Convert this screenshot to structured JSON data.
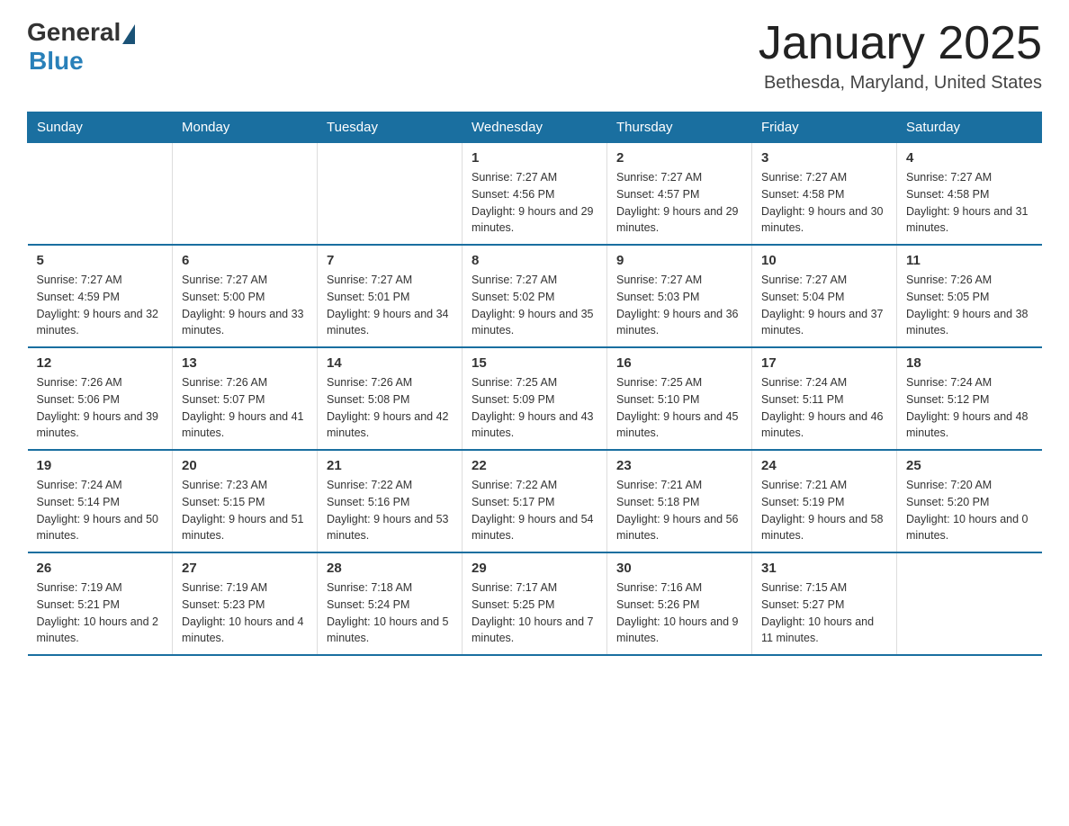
{
  "header": {
    "logo_general": "General",
    "logo_blue": "Blue",
    "month_title": "January 2025",
    "location": "Bethesda, Maryland, United States"
  },
  "days_of_week": [
    "Sunday",
    "Monday",
    "Tuesday",
    "Wednesday",
    "Thursday",
    "Friday",
    "Saturday"
  ],
  "weeks": [
    {
      "days": [
        {
          "number": "",
          "info": ""
        },
        {
          "number": "",
          "info": ""
        },
        {
          "number": "",
          "info": ""
        },
        {
          "number": "1",
          "info": "Sunrise: 7:27 AM\nSunset: 4:56 PM\nDaylight: 9 hours\nand 29 minutes."
        },
        {
          "number": "2",
          "info": "Sunrise: 7:27 AM\nSunset: 4:57 PM\nDaylight: 9 hours\nand 29 minutes."
        },
        {
          "number": "3",
          "info": "Sunrise: 7:27 AM\nSunset: 4:58 PM\nDaylight: 9 hours\nand 30 minutes."
        },
        {
          "number": "4",
          "info": "Sunrise: 7:27 AM\nSunset: 4:58 PM\nDaylight: 9 hours\nand 31 minutes."
        }
      ]
    },
    {
      "days": [
        {
          "number": "5",
          "info": "Sunrise: 7:27 AM\nSunset: 4:59 PM\nDaylight: 9 hours\nand 32 minutes."
        },
        {
          "number": "6",
          "info": "Sunrise: 7:27 AM\nSunset: 5:00 PM\nDaylight: 9 hours\nand 33 minutes."
        },
        {
          "number": "7",
          "info": "Sunrise: 7:27 AM\nSunset: 5:01 PM\nDaylight: 9 hours\nand 34 minutes."
        },
        {
          "number": "8",
          "info": "Sunrise: 7:27 AM\nSunset: 5:02 PM\nDaylight: 9 hours\nand 35 minutes."
        },
        {
          "number": "9",
          "info": "Sunrise: 7:27 AM\nSunset: 5:03 PM\nDaylight: 9 hours\nand 36 minutes."
        },
        {
          "number": "10",
          "info": "Sunrise: 7:27 AM\nSunset: 5:04 PM\nDaylight: 9 hours\nand 37 minutes."
        },
        {
          "number": "11",
          "info": "Sunrise: 7:26 AM\nSunset: 5:05 PM\nDaylight: 9 hours\nand 38 minutes."
        }
      ]
    },
    {
      "days": [
        {
          "number": "12",
          "info": "Sunrise: 7:26 AM\nSunset: 5:06 PM\nDaylight: 9 hours\nand 39 minutes."
        },
        {
          "number": "13",
          "info": "Sunrise: 7:26 AM\nSunset: 5:07 PM\nDaylight: 9 hours\nand 41 minutes."
        },
        {
          "number": "14",
          "info": "Sunrise: 7:26 AM\nSunset: 5:08 PM\nDaylight: 9 hours\nand 42 minutes."
        },
        {
          "number": "15",
          "info": "Sunrise: 7:25 AM\nSunset: 5:09 PM\nDaylight: 9 hours\nand 43 minutes."
        },
        {
          "number": "16",
          "info": "Sunrise: 7:25 AM\nSunset: 5:10 PM\nDaylight: 9 hours\nand 45 minutes."
        },
        {
          "number": "17",
          "info": "Sunrise: 7:24 AM\nSunset: 5:11 PM\nDaylight: 9 hours\nand 46 minutes."
        },
        {
          "number": "18",
          "info": "Sunrise: 7:24 AM\nSunset: 5:12 PM\nDaylight: 9 hours\nand 48 minutes."
        }
      ]
    },
    {
      "days": [
        {
          "number": "19",
          "info": "Sunrise: 7:24 AM\nSunset: 5:14 PM\nDaylight: 9 hours\nand 50 minutes."
        },
        {
          "number": "20",
          "info": "Sunrise: 7:23 AM\nSunset: 5:15 PM\nDaylight: 9 hours\nand 51 minutes."
        },
        {
          "number": "21",
          "info": "Sunrise: 7:22 AM\nSunset: 5:16 PM\nDaylight: 9 hours\nand 53 minutes."
        },
        {
          "number": "22",
          "info": "Sunrise: 7:22 AM\nSunset: 5:17 PM\nDaylight: 9 hours\nand 54 minutes."
        },
        {
          "number": "23",
          "info": "Sunrise: 7:21 AM\nSunset: 5:18 PM\nDaylight: 9 hours\nand 56 minutes."
        },
        {
          "number": "24",
          "info": "Sunrise: 7:21 AM\nSunset: 5:19 PM\nDaylight: 9 hours\nand 58 minutes."
        },
        {
          "number": "25",
          "info": "Sunrise: 7:20 AM\nSunset: 5:20 PM\nDaylight: 10 hours\nand 0 minutes."
        }
      ]
    },
    {
      "days": [
        {
          "number": "26",
          "info": "Sunrise: 7:19 AM\nSunset: 5:21 PM\nDaylight: 10 hours\nand 2 minutes."
        },
        {
          "number": "27",
          "info": "Sunrise: 7:19 AM\nSunset: 5:23 PM\nDaylight: 10 hours\nand 4 minutes."
        },
        {
          "number": "28",
          "info": "Sunrise: 7:18 AM\nSunset: 5:24 PM\nDaylight: 10 hours\nand 5 minutes."
        },
        {
          "number": "29",
          "info": "Sunrise: 7:17 AM\nSunset: 5:25 PM\nDaylight: 10 hours\nand 7 minutes."
        },
        {
          "number": "30",
          "info": "Sunrise: 7:16 AM\nSunset: 5:26 PM\nDaylight: 10 hours\nand 9 minutes."
        },
        {
          "number": "31",
          "info": "Sunrise: 7:15 AM\nSunset: 5:27 PM\nDaylight: 10 hours\nand 11 minutes."
        },
        {
          "number": "",
          "info": ""
        }
      ]
    }
  ]
}
